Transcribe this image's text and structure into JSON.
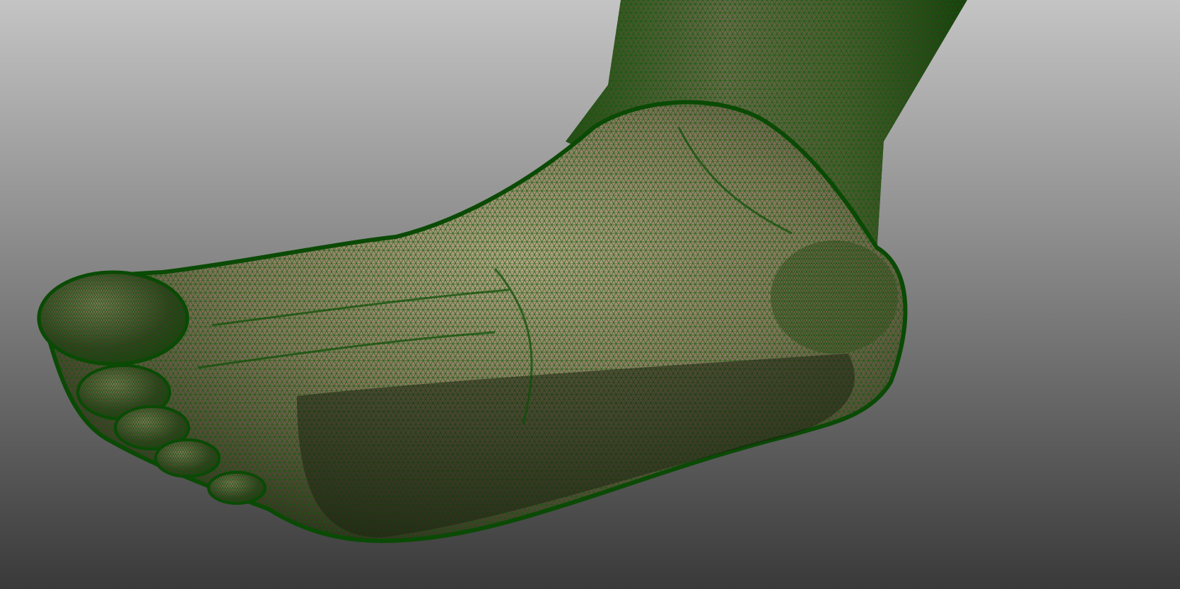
{
  "viewport": {
    "background_top": "#c4c4c4",
    "background_bottom": "#3a3a3a",
    "render_mode": "shaded-wireframe"
  },
  "model": {
    "name": "foot",
    "surface_color": "#8a7760",
    "wireframe_color": "#0b5c06",
    "silhouette_color": "#0a4a05"
  }
}
